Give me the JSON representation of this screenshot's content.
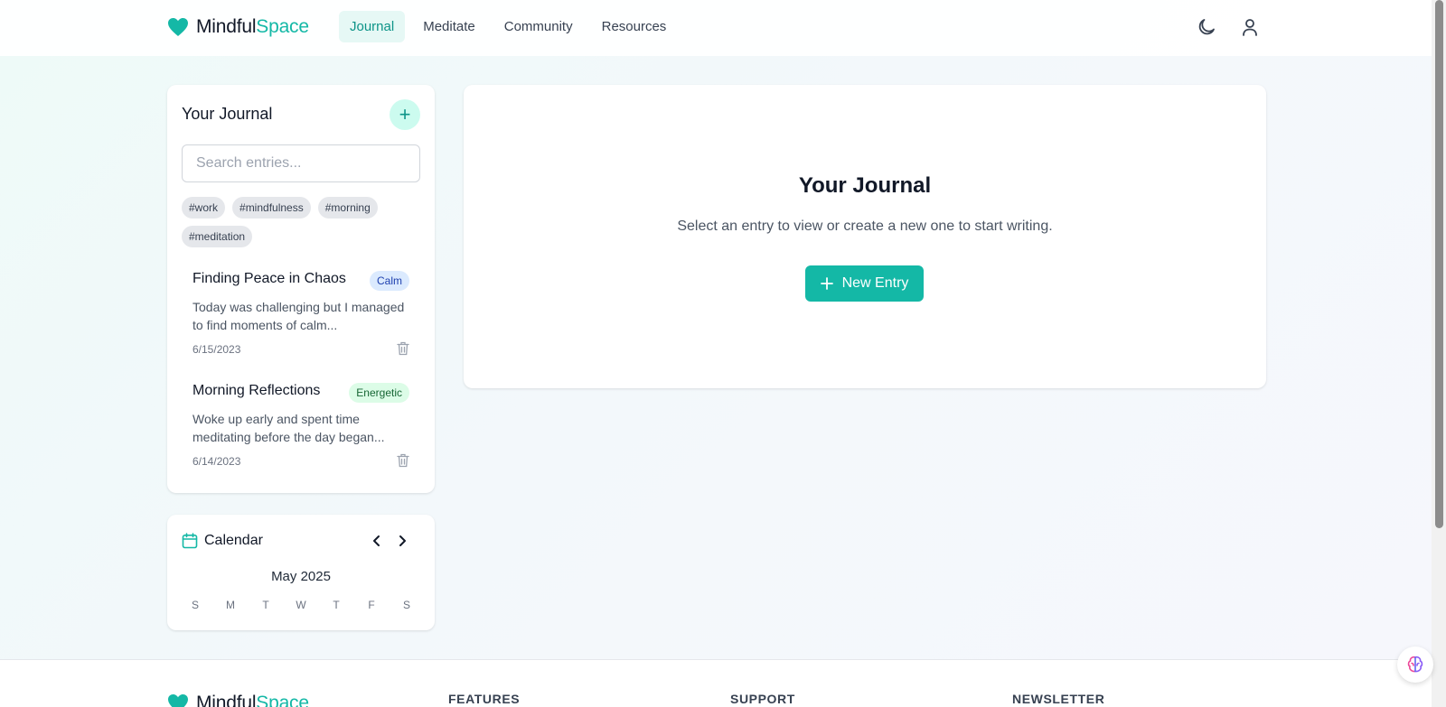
{
  "brand": {
    "name_main": "Mindful",
    "name_accent": "Space",
    "accent_color": "#14b8a6"
  },
  "nav": {
    "links": [
      {
        "label": "Journal",
        "active": true
      },
      {
        "label": "Meditate",
        "active": false
      },
      {
        "label": "Community",
        "active": false
      },
      {
        "label": "Resources",
        "active": false
      }
    ],
    "icons": [
      "moon-icon",
      "user-icon"
    ]
  },
  "journal": {
    "title": "Your Journal",
    "add_label": "+",
    "search_placeholder": "Search entries...",
    "tags": [
      "#work",
      "#mindfulness",
      "#morning",
      "#meditation"
    ],
    "entries": [
      {
        "title": "Finding Peace in Chaos",
        "mood": "Calm",
        "preview": "Today was challenging but I managed to find moments of calm...",
        "date": "6/15/2023"
      },
      {
        "title": "Morning Reflections",
        "mood": "Energetic",
        "preview": "Woke up early and spent time meditating before the day began...",
        "date": "6/14/2023"
      }
    ]
  },
  "calendar": {
    "title": "Calendar",
    "month": "May 2025",
    "weekdays": [
      "S",
      "M",
      "T",
      "W",
      "T",
      "F",
      "S"
    ]
  },
  "main": {
    "title": "Your Journal",
    "subtitle": "Select an entry to view or create a new one to start writing.",
    "new_entry_label": "New Entry"
  },
  "footer": {
    "columns": [
      "FEATURES",
      "SUPPORT",
      "NEWSLETTER"
    ]
  }
}
